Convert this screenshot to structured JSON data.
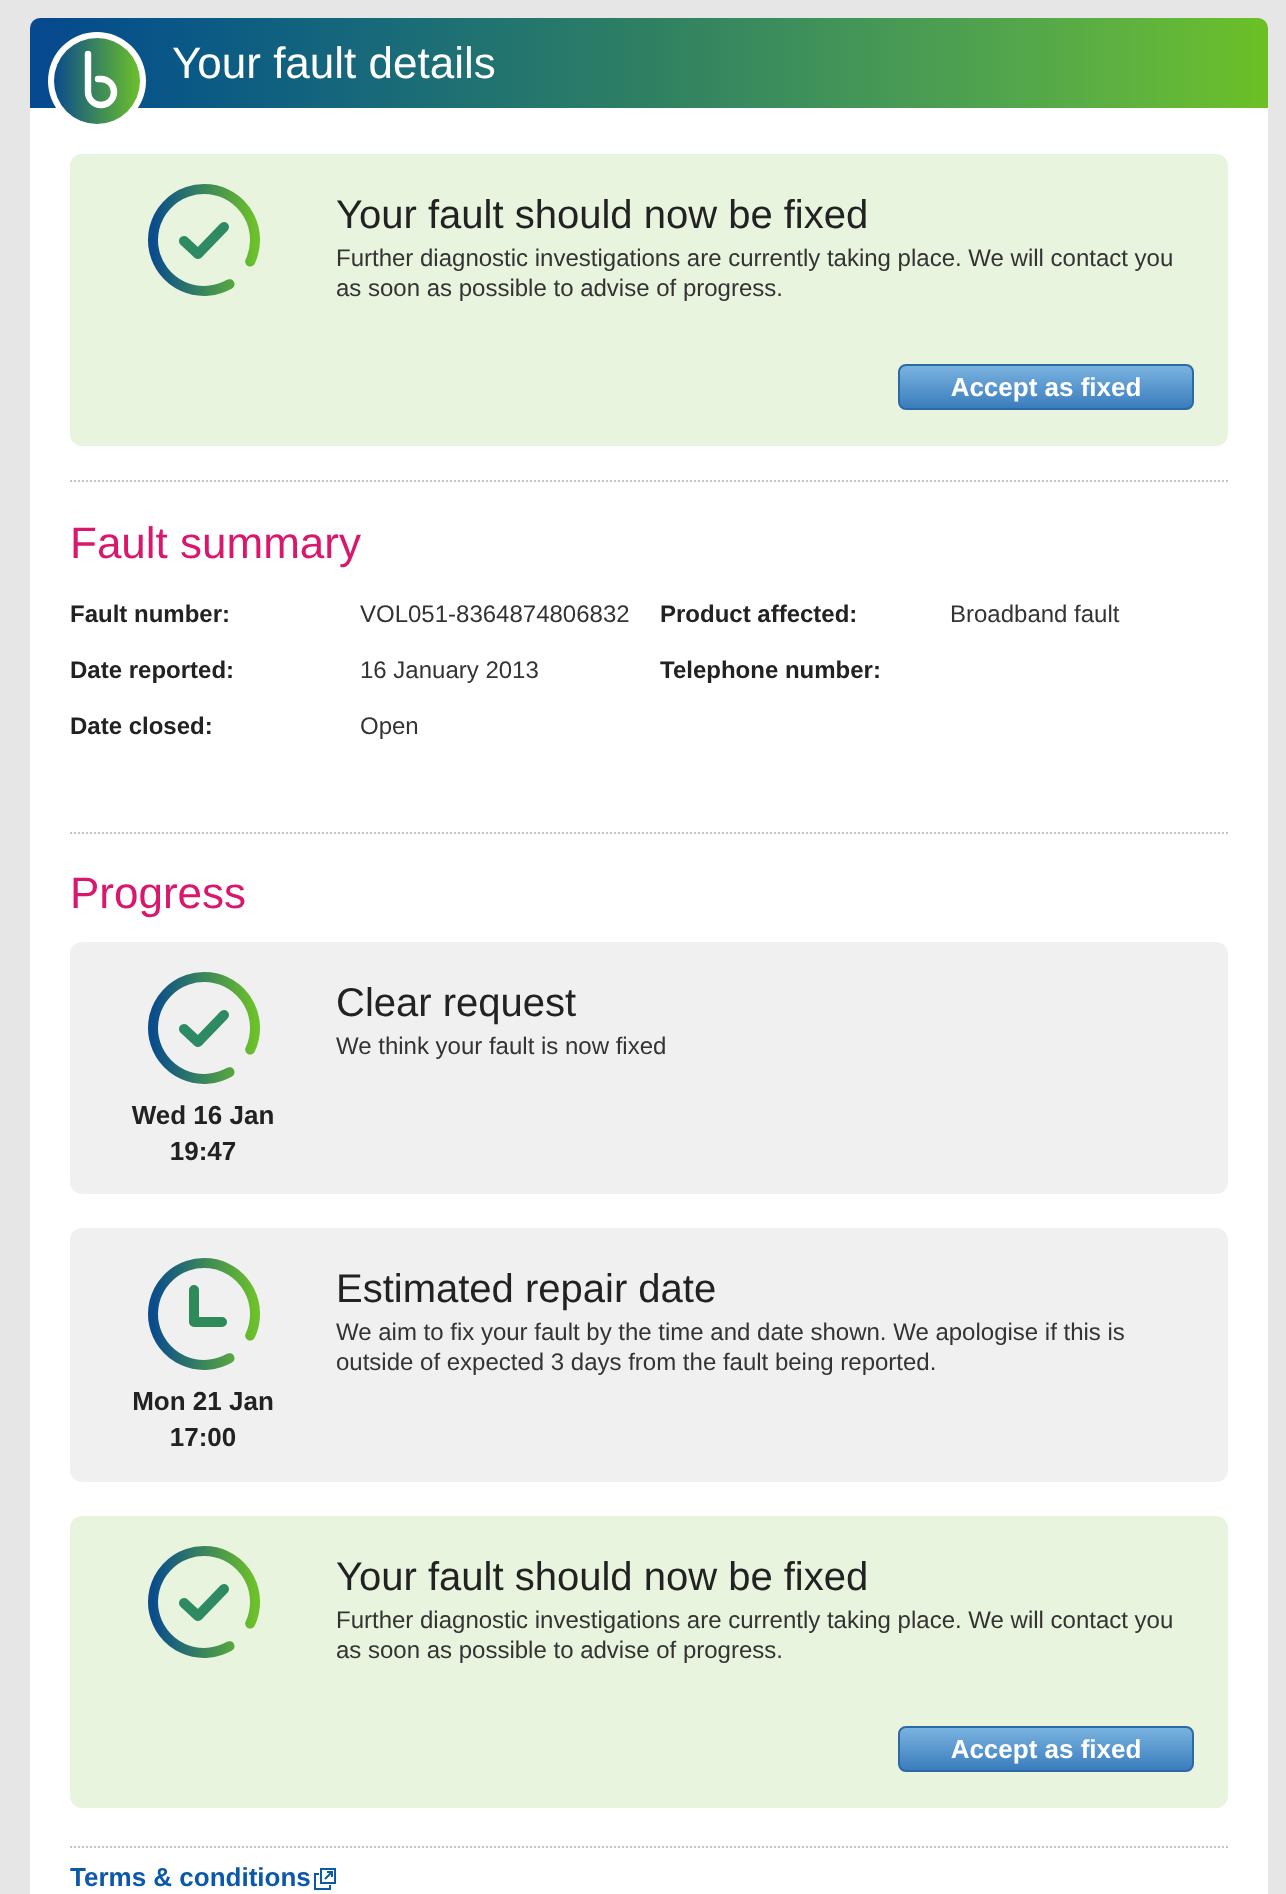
{
  "header": {
    "title": "Your fault details"
  },
  "status_panel": {
    "kind": "fixed_notice",
    "title": "Your fault should now be fixed",
    "description": "Further diagnostic investigations are currently taking place. We will contact you as soon as possible to advise of progress.",
    "button": "Accept as fixed"
  },
  "fault_summary": {
    "heading": "Fault summary",
    "fields": [
      {
        "label": "Fault number:",
        "value": "VOL051-8364874806832"
      },
      {
        "label": "Product affected:",
        "value": "Broadband fault"
      },
      {
        "label": "Date reported:",
        "value": "16 January 2013"
      },
      {
        "label": "Telephone number:"
      },
      {
        "label": "Date closed:",
        "value": "Open"
      }
    ]
  },
  "progress": {
    "heading": "Progress",
    "items": [
      {
        "kind": "cleared",
        "date": "Wed 16 Jan",
        "time": "19:47",
        "title": "Clear request",
        "description": "We think your fault is now fixed"
      },
      {
        "kind": "estimate",
        "date": "Mon 21 Jan",
        "time": "17:00",
        "title": "Estimated repair date",
        "description": "We aim to fix your fault by the time and date shown. We apologise if this is outside of expected 3 days from the fault being reported."
      },
      {
        "kind": "fixed_notice",
        "title": "Your fault should now be fixed",
        "description": "Further diagnostic investigations are currently taking place. We will contact you as soon as possible to advise of progress.",
        "button": "Accept as fixed"
      }
    ]
  },
  "footer": {
    "link": "Terms & conditions"
  }
}
